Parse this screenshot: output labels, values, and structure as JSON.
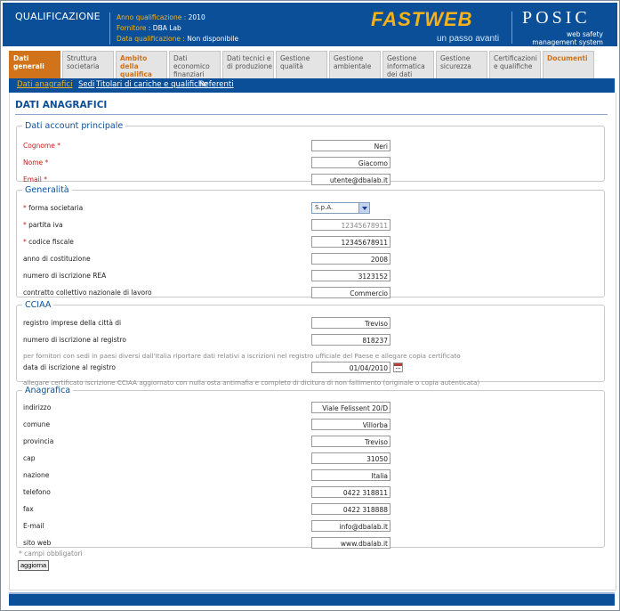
{
  "header": {
    "title": "QUALIFICAZIONE",
    "meta": [
      {
        "label": "Anno qualificazione :",
        "value": "2010"
      },
      {
        "label": "Fornitore",
        "value": ": DBA Lab"
      },
      {
        "label": "Data qualificazione :",
        "value": "Non disponibile"
      }
    ],
    "brand": "FASTWEB",
    "slogan": "un passo avanti",
    "product": "POSIC",
    "product_sub_1": "web safety",
    "product_sub_2": "management system"
  },
  "tabs": [
    {
      "label": "Dati generali",
      "state": "active"
    },
    {
      "label": "Struttura societaria",
      "state": "normal"
    },
    {
      "label": "Ambito della qualifica",
      "state": "highlight"
    },
    {
      "label": "Dati economico finanziari",
      "state": "normal"
    },
    {
      "label": "Dati tecnici e di produzione",
      "state": "normal"
    },
    {
      "label": "Gestione qualità",
      "state": "normal"
    },
    {
      "label": "Gestione ambientale",
      "state": "normal"
    },
    {
      "label": "Gestione informatica dei dati",
      "state": "normal"
    },
    {
      "label": "Gestione sicurezza",
      "state": "normal"
    },
    {
      "label": "Certificazioni e qualifiche",
      "state": "normal"
    },
    {
      "label": "Documenti",
      "state": "highlight"
    }
  ],
  "subnav": [
    "Dati anagrafici",
    "Sedi",
    "Titolari di cariche e qualifiche",
    "Referenti"
  ],
  "page_title": "DATI ANAGRAFICI",
  "account": {
    "legend": "Dati account principale",
    "cognome_label": "Cognome *",
    "cognome": "Neri",
    "nome_label": "Nome *",
    "nome": "Giacomo",
    "email_label": "Email *",
    "email": "utente@dbalab.it"
  },
  "generalita": {
    "legend": "Generalità",
    "forma_label": "forma societaria",
    "forma": "S.p.A.",
    "piva_label": "partita iva",
    "piva": "12345678911",
    "cf_label": "codice fiscale",
    "cf": "12345678911",
    "anno_label": "anno di costituzione",
    "anno": "2008",
    "rea_label": "numero di iscrizione REA",
    "rea": "3123152",
    "ccnl_label": "contratto collettivo nazionale di lavoro",
    "ccnl": "Commercio"
  },
  "cciaa": {
    "legend": "CCIAA",
    "citta_label": "registro imprese della città di",
    "citta": "Treviso",
    "num_label": "numero di iscrizione al registro",
    "num": "818237",
    "note1": "per fornitori con sedi in paesi diversi dall'Italia riportare dati relativi a iscrizioni nel registro ufficiale del Paese e allegare copia certificato",
    "data_label": "data di iscrizione al registro",
    "data": "01/04/2010",
    "note2": "allegare certificato iscrizione CCIAA aggiornato con nulla osta antimafia e completo di dicitura di non fallimento (originale o copia autenticata)"
  },
  "anagrafica": {
    "legend": "Anagrafica",
    "rows": [
      {
        "label": "indirizzo",
        "value": "Viale Felissent 20/D"
      },
      {
        "label": "comune",
        "value": "Villorba"
      },
      {
        "label": "provincia",
        "value": "Treviso"
      },
      {
        "label": "cap",
        "value": "31050"
      },
      {
        "label": "nazione",
        "value": "Italia"
      },
      {
        "label": "telefono",
        "value": "0422 318811"
      },
      {
        "label": "fax",
        "value": "0422 318888"
      },
      {
        "label": "E-mail",
        "value": "info@dbalab.it"
      },
      {
        "label": "sito web",
        "value": "www.dbalab.it"
      }
    ]
  },
  "required_note": "* campi obbligatori",
  "update_button": "aggiorna"
}
